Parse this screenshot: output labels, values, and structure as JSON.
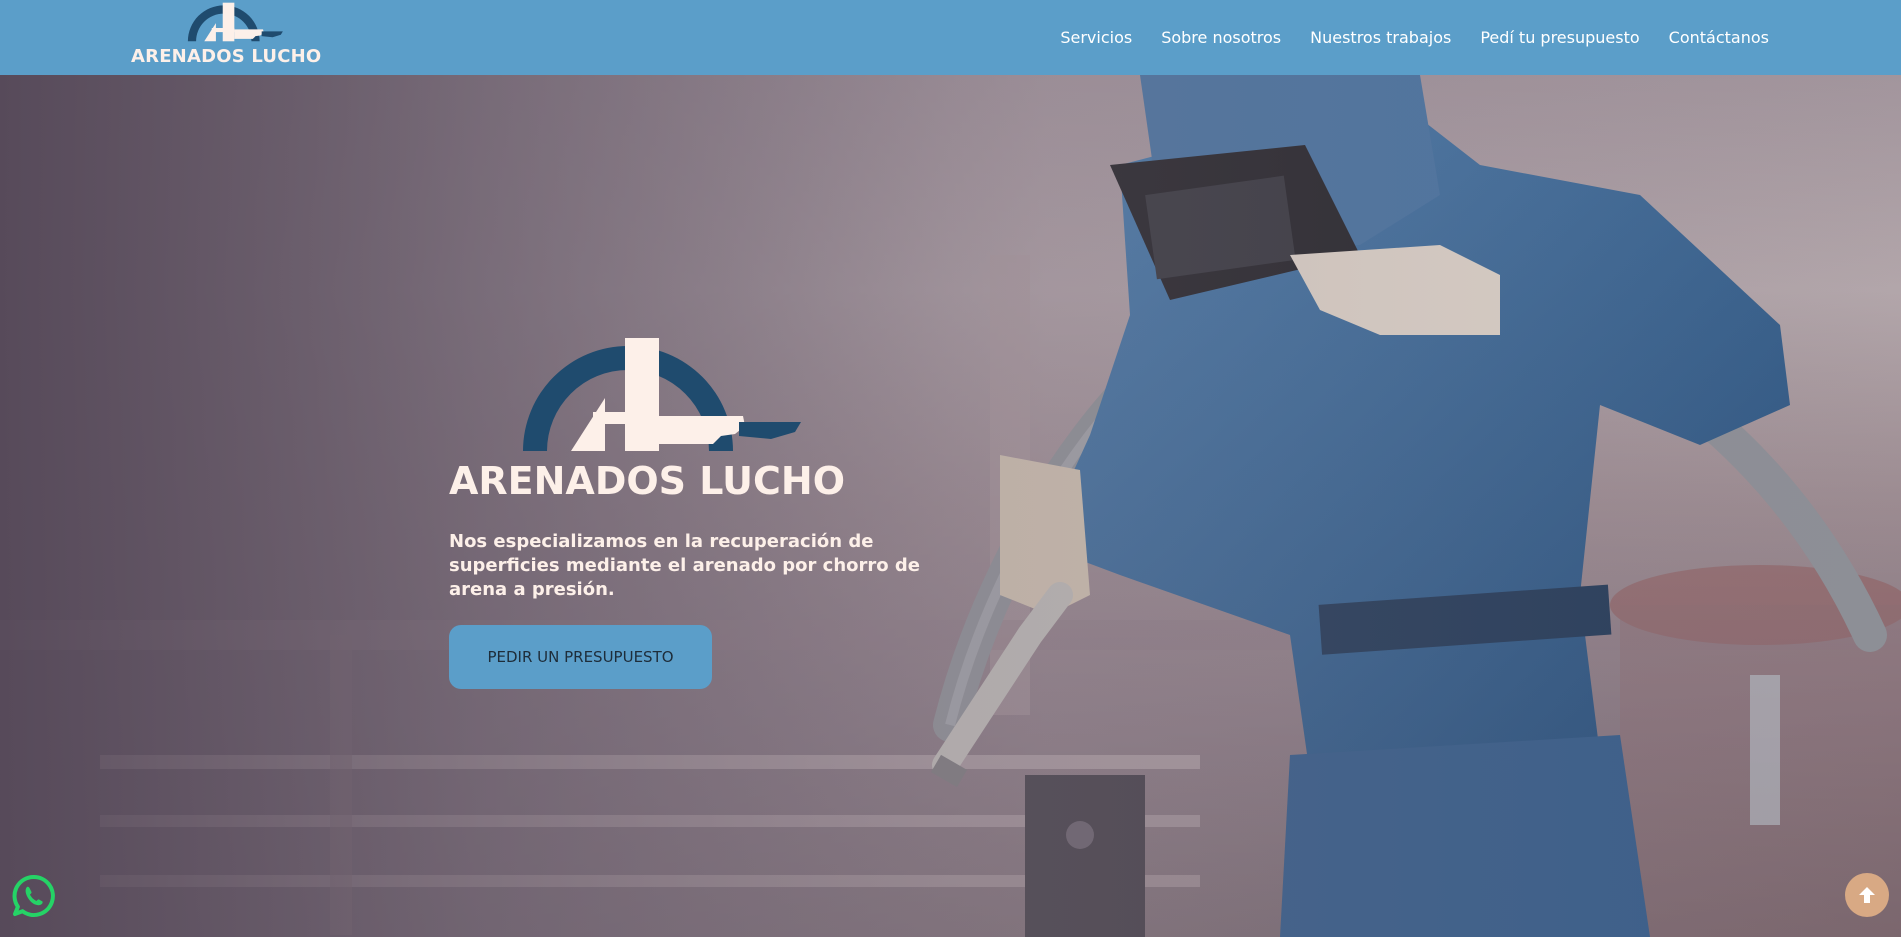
{
  "brand": {
    "name": "ARENADOS LUCHO",
    "logo_icon": "al-logo-icon"
  },
  "nav": {
    "items": [
      {
        "label": "Servicios"
      },
      {
        "label": "Sobre nosotros"
      },
      {
        "label": "Nuestros trabajos"
      },
      {
        "label": "Pedí tu presupuesto"
      },
      {
        "label": "Contáctanos"
      }
    ]
  },
  "hero": {
    "title": "ARENADOS LUCHO",
    "description": "Nos especializamos en la recuperación de superficies mediante el arenado por chorro de arena a presión.",
    "cta_label": "PEDIR UN PRESUPUESTO",
    "background_icon": "sandblasting-worker-photo"
  },
  "floating": {
    "whatsapp_icon": "whatsapp-icon",
    "scroll_top_icon": "arrow-up-icon"
  },
  "colors": {
    "header_bg": "#5b9ec9",
    "logo_dark": "#1f4b6e",
    "logo_light": "#fdf0e9",
    "cta_bg": "#5b9ec9",
    "whatsapp": "#25d366",
    "scroll_top_bg": "#d8a984"
  }
}
